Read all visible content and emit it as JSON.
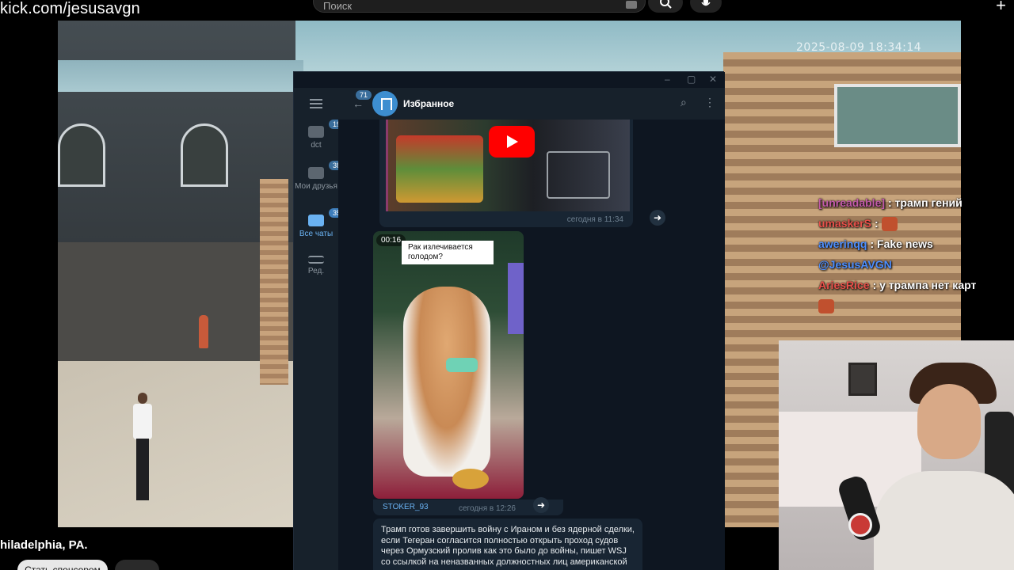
{
  "browser": {
    "url": "kick.com/jesusavgn",
    "search_placeholder": "Поиск"
  },
  "stream": {
    "timestamp": "2025-08-09 18:34:14",
    "location": "hiladelphia, PA.",
    "subscribe_label": "Стать спонсором"
  },
  "chat": [
    {
      "user": "[unreadable]",
      "user_color": "#c25aa9",
      "text": ": трамп гений"
    },
    {
      "user": "umaskerS",
      "user_color": "#e8504a",
      "text": ":",
      "emote": true
    },
    {
      "user": "awerinqq",
      "user_color": "#4d8fff",
      "text": ": Fake news"
    },
    {
      "user": "@JesusAVGN",
      "user_color": "#4d8fff",
      "text": ""
    },
    {
      "user": "AriesRice",
      "user_color": "#e8504a",
      "text": ": у трампа нет карт"
    },
    {
      "user": "",
      "user_color": "#e8504a",
      "text": "",
      "emote": true
    }
  ],
  "telegram": {
    "title": "Избранное",
    "back_badge": "71",
    "folders": [
      {
        "label": "dct",
        "badge": "193",
        "active": false
      },
      {
        "label": "Мои друзья",
        "badge": "38",
        "active": false
      },
      {
        "label": "Все чаты",
        "badge": "357",
        "active": true
      },
      {
        "label": "Ред.",
        "badge": "",
        "active": false
      }
    ],
    "messages": {
      "first_time": "сегодня в 11:34",
      "video_duration": "00:16",
      "video_caption": "Рак излечивается голодом?",
      "video_author": "STOKER_93",
      "video_time": "сегодня в 12:26",
      "text": "Трамп готов завершить войну с Ираном и без ядерной сделки, если Тегеран согласится полностью открыть проход судов через Ормузский пролив как это было до войны, пишет WSJ со ссылкой на неназванных должностных лиц американской"
    }
  },
  "colors": {
    "tg_bg": "#0e1621",
    "tg_panel": "#17212b",
    "tg_bubble": "#182533",
    "tg_accent": "#6ab2f2"
  }
}
